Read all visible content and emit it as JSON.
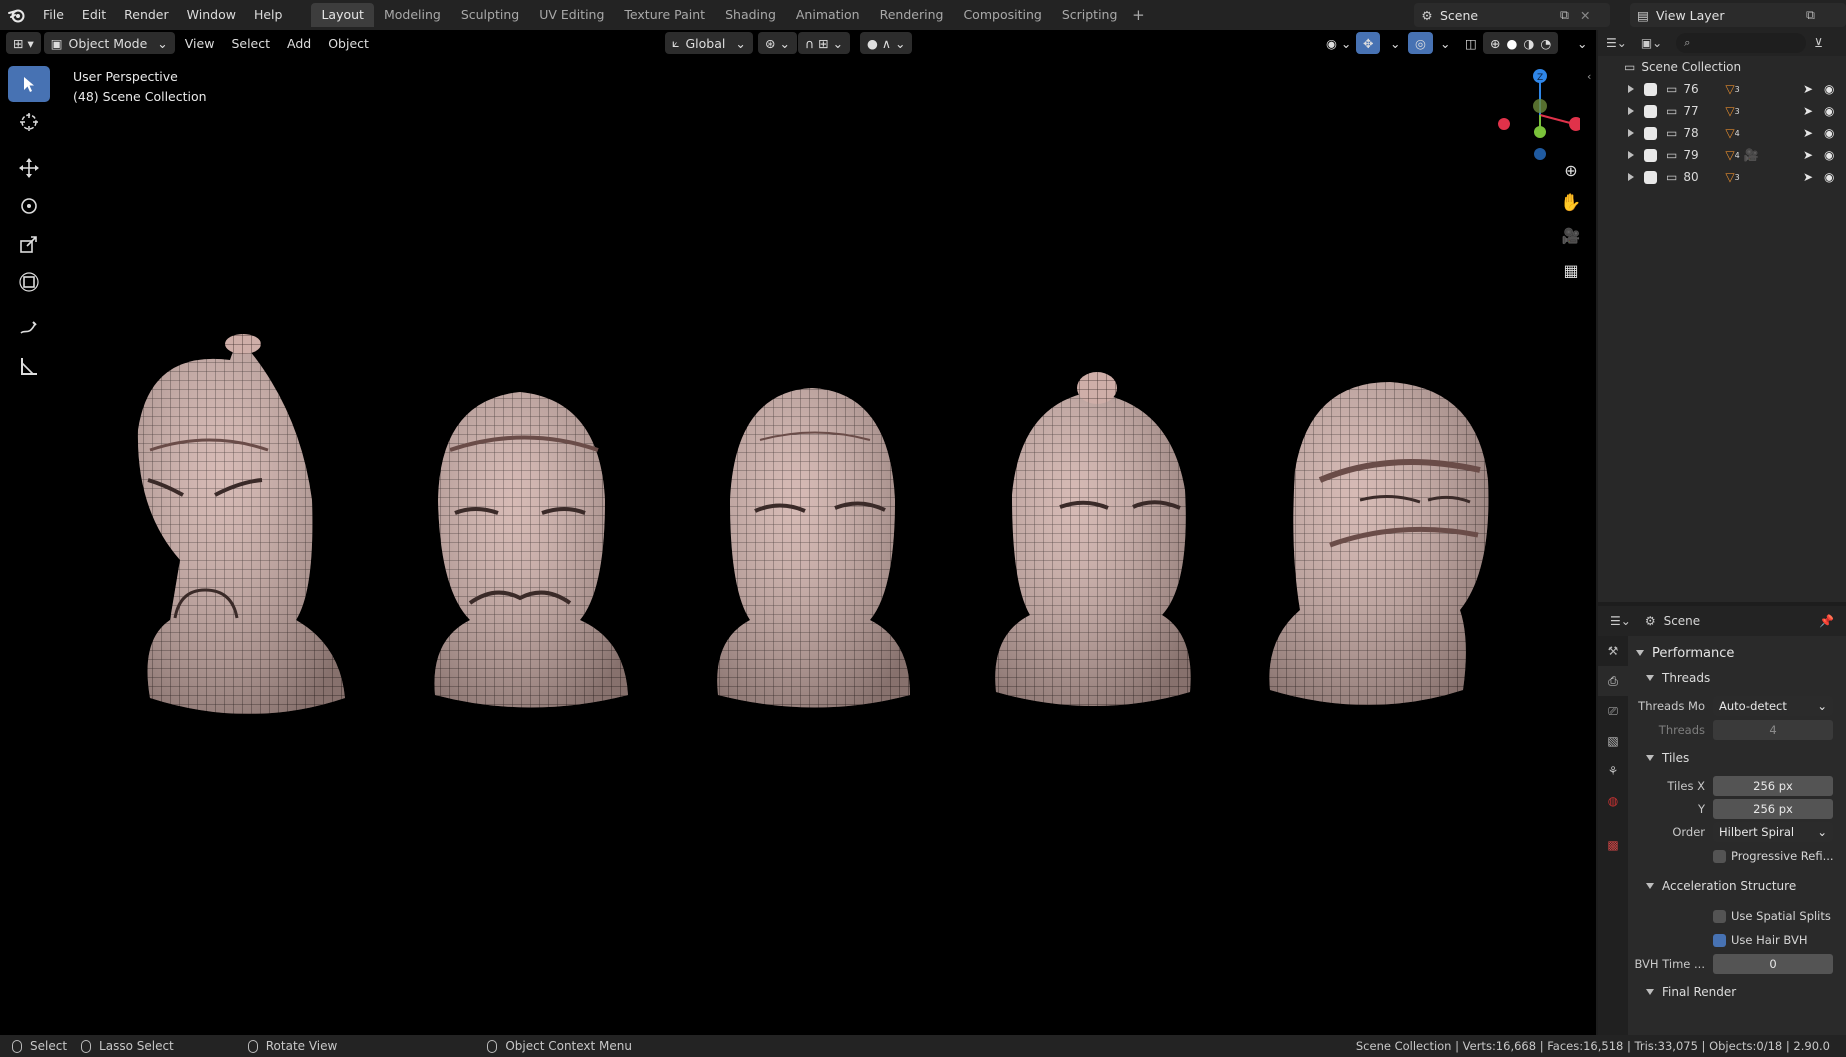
{
  "menu": [
    "File",
    "Edit",
    "Render",
    "Window",
    "Help"
  ],
  "workspace_tabs": [
    "Layout",
    "Modeling",
    "Sculpting",
    "UV Editing",
    "Texture Paint",
    "Shading",
    "Animation",
    "Rendering",
    "Compositing",
    "Scripting"
  ],
  "active_workspace": "Layout",
  "scene_name": "Scene",
  "view_layer_name": "View Layer",
  "viewport": {
    "mode": "Object Mode",
    "view_menu": "View",
    "select_menu": "Select",
    "add_menu": "Add",
    "object_menu": "Object",
    "orientation": "Global",
    "perspective_label": "User Perspective",
    "collection_label": "(48) Scene Collection",
    "mesh_color": "#c9a8a2",
    "wire_color": "#2a1e1c"
  },
  "outliner": {
    "root": "Scene Collection",
    "collections": [
      {
        "name": "76",
        "modifier_count": "3"
      },
      {
        "name": "77",
        "modifier_count": "3"
      },
      {
        "name": "78",
        "modifier_count": "4"
      },
      {
        "name": "79",
        "modifier_count": "4"
      },
      {
        "name": "80",
        "modifier_count": "3"
      }
    ]
  },
  "properties": {
    "context": "Scene",
    "performance_label": "Performance",
    "threads_section": "Threads",
    "threads_mode_label": "Threads Mo",
    "threads_mode_value": "Auto-detect",
    "threads_label": "Threads",
    "threads_value": "4",
    "tiles_section": "Tiles",
    "tiles_x_label": "Tiles X",
    "tiles_x_value": "256 px",
    "tiles_y_label": "Y",
    "tiles_y_value": "256 px",
    "order_label": "Order",
    "order_value": "Hilbert Spiral",
    "progressive_label": "Progressive Refi...",
    "accel_section": "Acceleration Structure",
    "spatial_splits_label": "Use Spatial Splits",
    "hair_bvh_label": "Use Hair BVH",
    "bvh_time_label": "BVH Time ...",
    "bvh_time_value": "0",
    "final_render_section": "Final Render"
  },
  "statusbar": {
    "select": "Select",
    "lasso": "Lasso Select",
    "rotate": "Rotate View",
    "context_menu": "Object Context Menu",
    "stats": "Scene Collection | Verts:16,668 | Faces:16,518 | Tris:33,075 | Objects:0/18 | 2.90.0"
  },
  "colors": {
    "accent": "#4772b3",
    "axis_x": "#e0324a",
    "axis_y": "#7ac23a",
    "axis_z": "#2f86e8",
    "modifier_orange": "#e08a2e"
  }
}
